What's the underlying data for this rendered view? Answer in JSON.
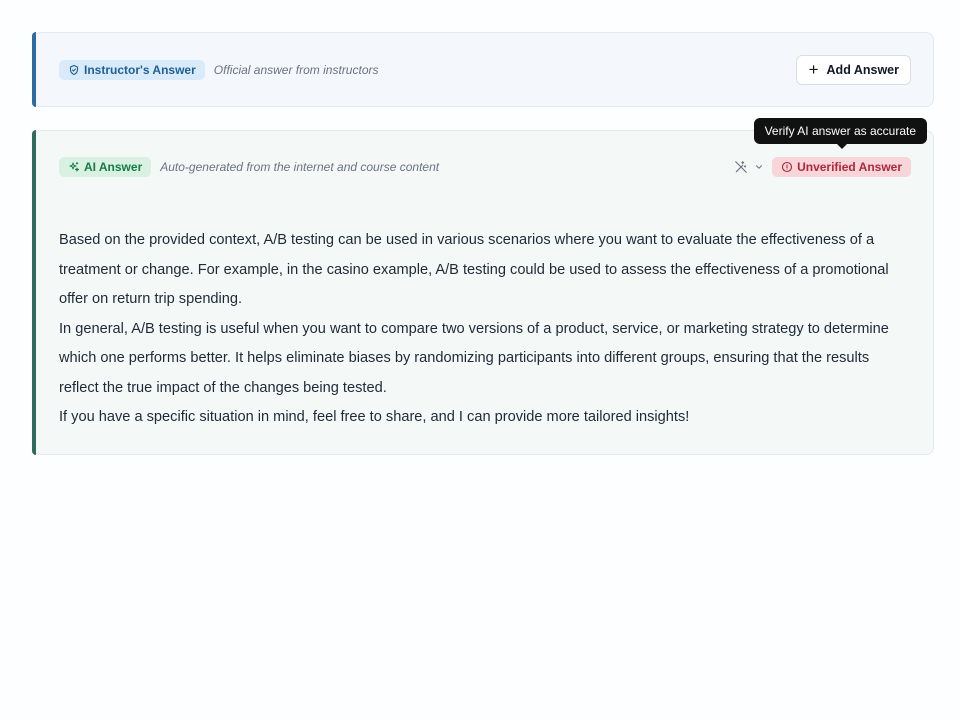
{
  "instructor": {
    "badge_label": "Instructor's Answer",
    "subtitle": "Official answer from instructors",
    "add_button_label": "Add Answer",
    "badge_icon": "shield-check-icon",
    "accent_color": "#2f6aa3"
  },
  "ai": {
    "badge_label": "AI Answer",
    "badge_icon": "sparkles-icon",
    "subtitle": "Auto-generated from the internet and course content",
    "tooltip": "Verify AI answer as accurate",
    "status_label": "Unverified Answer",
    "status_color": "#b0283a",
    "accent_color": "#2f6b5e",
    "paragraphs": [
      "Based on the provided context, A/B testing can be used in various scenarios where you want to evaluate the effectiveness of a treatment or change. For example, in the casino example, A/B testing could be used to assess the effectiveness of a promotional offer on return trip spending.",
      "In general, A/B testing is useful when you want to compare two versions of a product, service, or marketing strategy to determine which one performs better. It helps eliminate biases by randomizing participants into different groups, ensuring that the results reflect the true impact of the changes being tested.",
      "If you have a specific situation in mind, feel free to share, and I can provide more tailored insights!"
    ]
  }
}
